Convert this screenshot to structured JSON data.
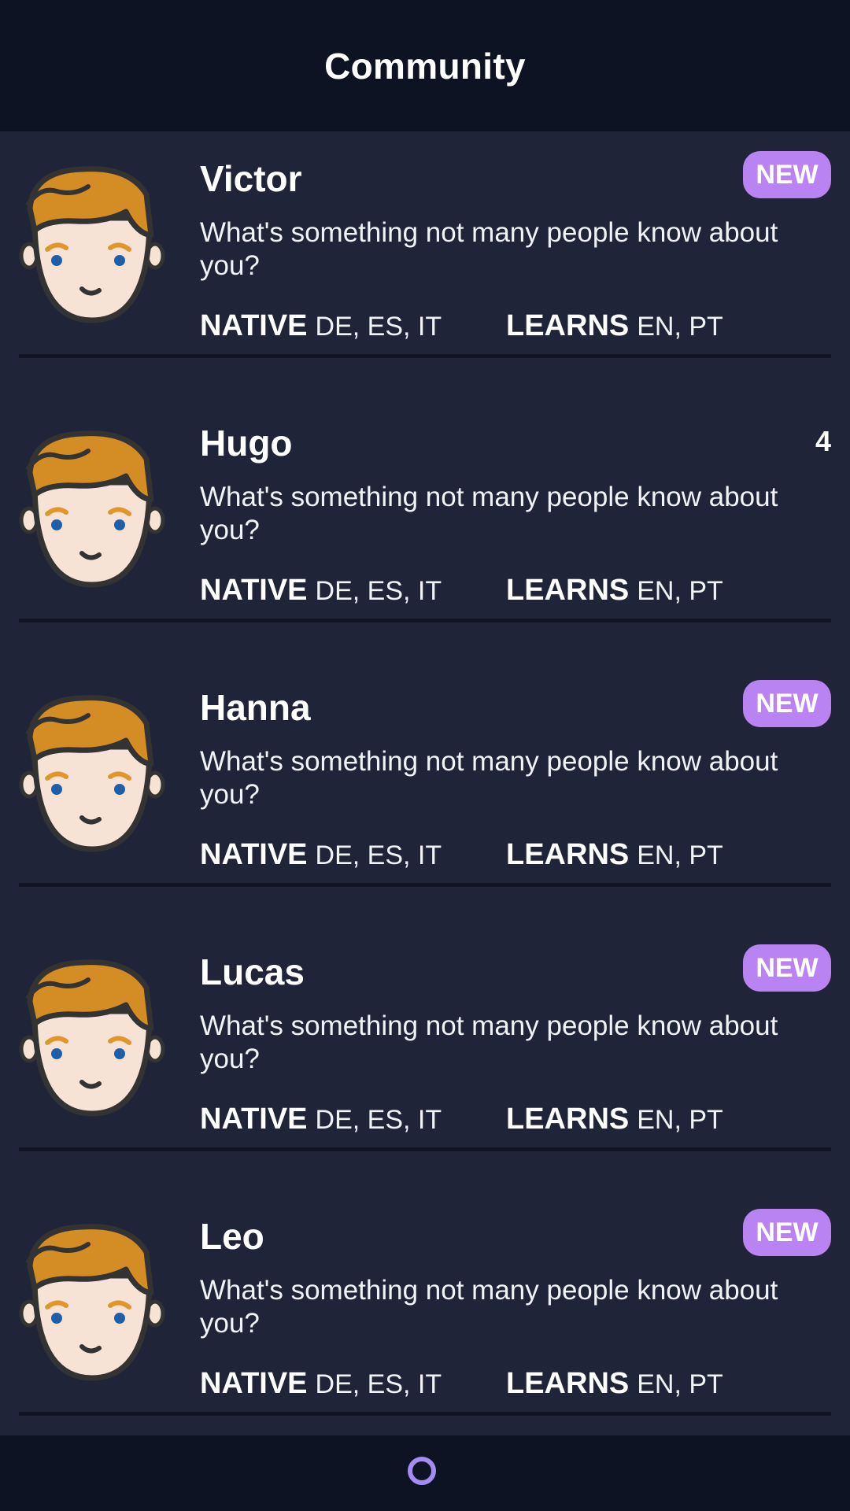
{
  "header": {
    "title": "Community"
  },
  "colors": {
    "header_bg": "#0e1324",
    "list_bg": "#202438",
    "badge": "#b983f2",
    "spinner": "#a58cf2"
  },
  "labels": {
    "native": "NATIVE",
    "learns": "LEARNS"
  },
  "users": [
    {
      "name": "Victor",
      "badge": "NEW",
      "count": "",
      "message": "What's something not many people know about you?",
      "native": "DE, ES, IT",
      "learns": "EN, PT",
      "avatar_icon": "boy-avatar-icon"
    },
    {
      "name": "Hugo",
      "badge": "",
      "count": "4",
      "message": "What's something not many people know about you?",
      "native": "DE, ES, IT",
      "learns": "EN, PT",
      "avatar_icon": "boy-avatar-icon"
    },
    {
      "name": "Hanna",
      "badge": "NEW",
      "count": "",
      "message": "What's something not many people know about you?",
      "native": "DE, ES, IT",
      "learns": "EN, PT",
      "avatar_icon": "boy-avatar-icon"
    },
    {
      "name": "Lucas",
      "badge": "NEW",
      "count": "",
      "message": "What's something not many people know about you?",
      "native": "DE, ES, IT",
      "learns": "EN, PT",
      "avatar_icon": "boy-avatar-icon"
    },
    {
      "name": "Leo",
      "badge": "NEW",
      "count": "",
      "message": "What's something not many people know about you?",
      "native": "DE, ES, IT",
      "learns": "EN, PT",
      "avatar_icon": "boy-avatar-icon"
    }
  ],
  "footer": {
    "loading_icon": "loading-spinner-icon"
  }
}
